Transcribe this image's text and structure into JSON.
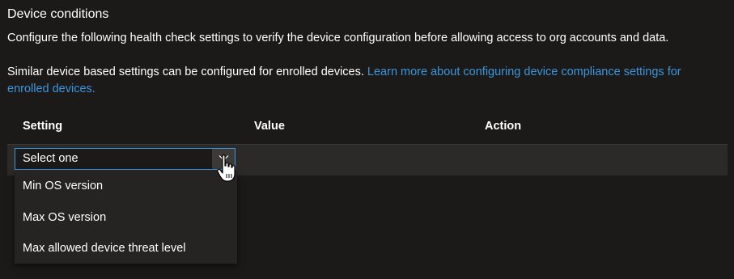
{
  "section": {
    "title": "Device conditions",
    "description": "Configure the following health check settings to verify the device configuration before allowing access to org accounts and data.",
    "note_text": "Similar device based settings can be configured for enrolled devices. ",
    "note_link": "Learn more about configuring device compliance settings for enrolled devices."
  },
  "table": {
    "columns": [
      "Setting",
      "Value",
      "Action"
    ]
  },
  "select": {
    "value": "Select one",
    "options": [
      "Min OS version",
      "Max OS version",
      "Max allowed device threat level"
    ]
  },
  "colors": {
    "background": "#1b1a19",
    "link": "#3a96dd",
    "focus_border": "#3a96dd"
  },
  "icons": {
    "dropdown": "chevron-down-icon",
    "cursor": "hand-pointer-icon"
  }
}
